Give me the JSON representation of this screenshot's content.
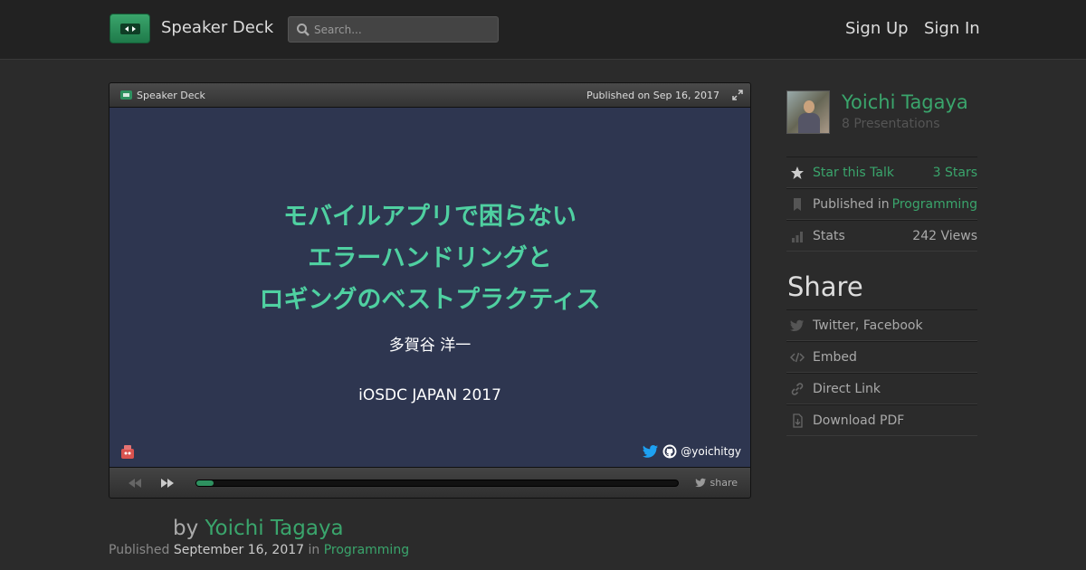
{
  "header": {
    "brand": "Speaker Deck",
    "search_placeholder": "Search...",
    "sign_up": "Sign Up",
    "sign_in": "Sign In"
  },
  "player": {
    "brand": "Speaker Deck",
    "published": "Published on Sep 16, 2017",
    "progress": 0.035,
    "share_label": "share",
    "slide": {
      "title_lines": [
        "モバイルアプリで困らない",
        "エラーハンドリングと",
        "ロギングのベストプラクティス"
      ],
      "author": "多賀谷 洋一",
      "event": "iOSDC JAPAN 2017",
      "handle": "@yoichitgy"
    }
  },
  "byline": {
    "prefix": "by",
    "author": "Yoichi Tagaya",
    "published_label": "Published",
    "published_date": "September 16, 2017",
    "in_label": "in",
    "category": "Programming"
  },
  "sidebar": {
    "author_name": "Yoichi Tagaya",
    "presentations": "8 Presentations",
    "star": {
      "label": "Star this Talk",
      "value": "3 Stars"
    },
    "published_in": {
      "label": "Published in",
      "value": "Programming"
    },
    "stats": {
      "label": "Stats",
      "value": "242 Views"
    },
    "share_title": "Share",
    "share_items": [
      "Twitter, Facebook",
      "Embed",
      "Direct Link",
      "Download PDF"
    ]
  },
  "colors": {
    "accent": "#3aa56c",
    "slide_bg": "#2e3650",
    "slide_title": "#4fd0a1"
  }
}
